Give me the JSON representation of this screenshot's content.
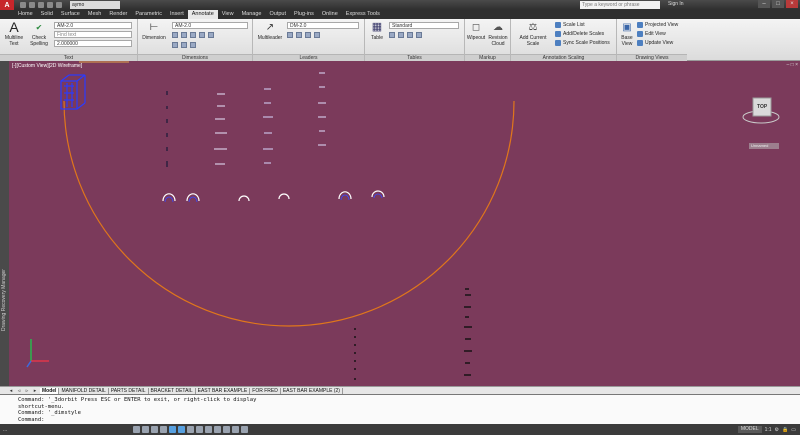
{
  "titlebar": {
    "logo": "A",
    "workspace": "aymo",
    "search_placeholder": "Type a keyword or phrase",
    "signin": "Sign In"
  },
  "tabs": [
    "Home",
    "Solid",
    "Surface",
    "Mesh",
    "Render",
    "Parametric",
    "Insert",
    "Annotate",
    "View",
    "Manage",
    "Output",
    "Plug-ins",
    "Online",
    "Express Tools"
  ],
  "active_tab": "Annotate",
  "ribbon": {
    "text_panel": {
      "multiline_text": "Multiline Text",
      "check_spelling": "Check Spelling",
      "style": "AM-2.0",
      "find_placeholder": "Find text",
      "height": "2.000000",
      "title": "Text"
    },
    "dimensions_panel": {
      "dimension": "Dimension",
      "style": "AM-2.0",
      "title": "Dimensions"
    },
    "leaders_panel": {
      "multileader": "Multileader",
      "style": "DM-2.0",
      "title": "Leaders"
    },
    "tables_panel": {
      "table": "Table",
      "style": "Standard",
      "title": "Tables"
    },
    "markup_panel": {
      "wipeout": "Wipeout",
      "revision_cloud": "Revision Cloud",
      "title": "Markup"
    },
    "annotation_scaling_panel": {
      "add_current_scale": "Add Current Scale",
      "scale_list": "Scale List",
      "add_delete_scales": "Add/Delete Scales",
      "sync_scale_positions": "Sync Scale Positions",
      "title": "Annotation Scaling"
    },
    "drawing_views_panel": {
      "base_view": "Base View",
      "projected_view": "Projected View",
      "edit_view": "Edit View",
      "update_view": "Update View",
      "title": "Drawing Views"
    }
  },
  "viewport": {
    "label": "[-][Custom View][2D Wireframe]",
    "viewcube_label": "TOP",
    "wcs_label": "Unnamed",
    "side_palette": "Drawing Recovery Manager"
  },
  "layout_tabs": [
    "Model",
    "MANIFOLD DETAIL",
    "PARTS DETAIL",
    "BRACKET DETAIL",
    "EAST BAR EXAMPLE",
    "FOR FRED",
    "EAST BAR EXAMPLE (2)"
  ],
  "active_layout": "Model",
  "command": {
    "lines": [
      "Command: '_3dorbit Press ESC or ENTER to exit, or right-click to display",
      "shortcut-menu.",
      "Command: '_dimstyle"
    ],
    "prompt": "Command:"
  },
  "status": {
    "coordinates": "...",
    "model": "MODEL",
    "scale": "1:1"
  }
}
